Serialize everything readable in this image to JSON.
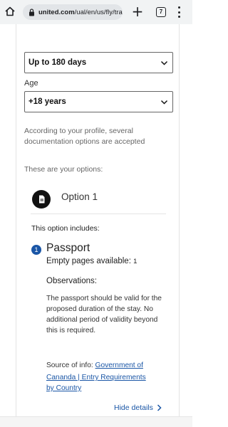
{
  "browser": {
    "url_domain": "united.com",
    "url_path": "/ual/en/us/fly/tra",
    "tab_count": "7",
    "icons": [
      "home-icon",
      "lock-icon",
      "plus-icon",
      "tabs-icon",
      "menu-icon"
    ]
  },
  "form": {
    "stay_value": "Up to 180 days",
    "age_label": "Age",
    "age_value": "+18 years"
  },
  "info": {
    "profile_note": "According to your profile, several documentation options are accepted",
    "options_intro": "These are your options:"
  },
  "option": {
    "title": "Option 1",
    "includes_label": "This option includes:",
    "item_number": "1",
    "document": "Passport",
    "pages_label": "Empty pages available:",
    "pages_value": "1",
    "observations_title": "Observations:",
    "observations_text": "The passport should be valid for the proposed duration of the stay. No additional period of validity beyond this is required.",
    "source_label": "Source of info:",
    "source_link_1": "Government of",
    "source_link_2": "Cananda | Entry Requirements",
    "source_link_3": "by Country",
    "hide_details": "Hide details"
  },
  "colors": {
    "link": "#1a56a6",
    "text": "#333333",
    "muted": "#666666"
  }
}
